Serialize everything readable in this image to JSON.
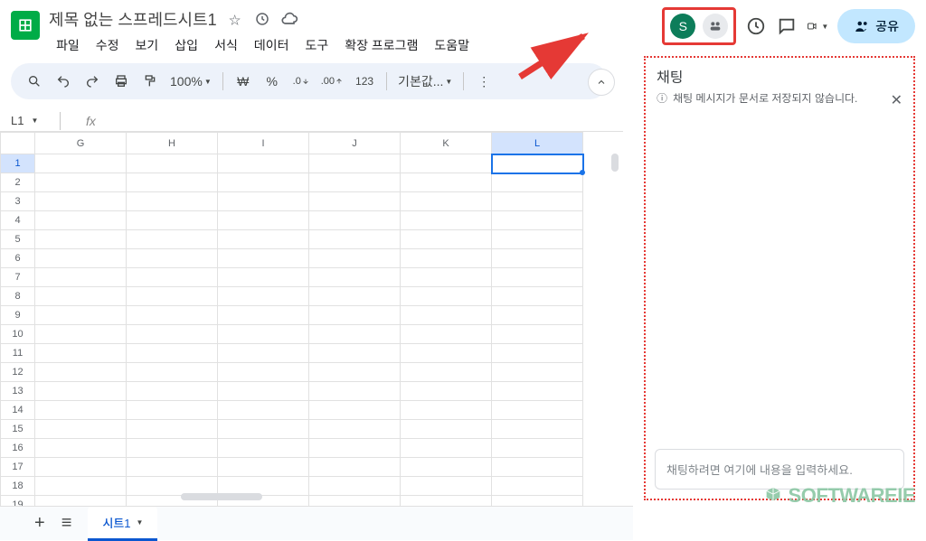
{
  "header": {
    "title": "제목 없는 스프레드시트1",
    "avatar_letter": "S",
    "share_label": "공유"
  },
  "menu": {
    "items": [
      "파일",
      "수정",
      "보기",
      "삽입",
      "서식",
      "데이터",
      "도구",
      "확장 프로그램",
      "도움말"
    ]
  },
  "toolbar": {
    "zoom": "100%",
    "currency": "₩",
    "percent": "%",
    "dec_dec": ".0",
    "inc_dec": ".00",
    "format123": "123",
    "font_default": "기본값..."
  },
  "namebox": {
    "cell": "L1"
  },
  "fx": {
    "label": "fx"
  },
  "grid": {
    "columns": [
      "G",
      "H",
      "I",
      "J",
      "K",
      "L"
    ],
    "selected_col": "L",
    "rows": [
      1,
      2,
      3,
      4,
      5,
      6,
      7,
      8,
      9,
      10,
      11,
      12,
      13,
      14,
      15,
      16,
      17,
      18,
      19
    ],
    "selected_row": 1
  },
  "chat": {
    "title": "채팅",
    "info": "채팅 메시지가 문서로 저장되지 않습니다.",
    "placeholder": "채팅하려면 여기에 내용을 입력하세요."
  },
  "sheetbar": {
    "tab": "시트1"
  },
  "watermark": "SOFTWAREIE"
}
